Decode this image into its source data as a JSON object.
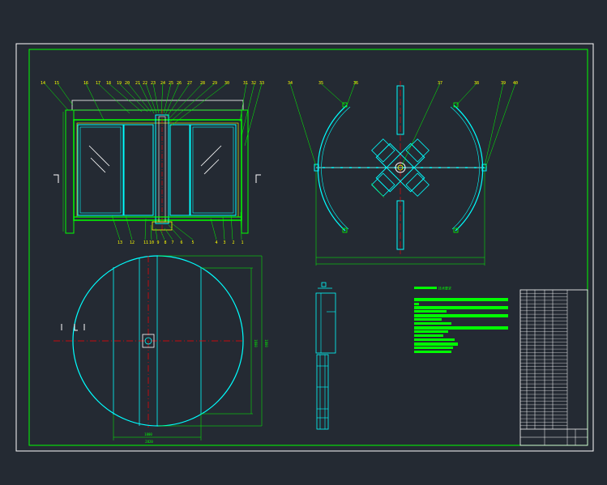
{
  "colors": {
    "background": "#242a33",
    "sheet_border": "#ffffff",
    "frame": "#00ff00",
    "outline": "#00ffff",
    "centerline": "#ff0000",
    "leader": "#00ff00",
    "dimension": "#00ff00",
    "note_text": "#00ff00",
    "glass": "#ffffff",
    "label": "#ffff00"
  },
  "front_view": {
    "top_callouts": [
      "14",
      "15",
      "16",
      "17",
      "18",
      "19",
      "20",
      "21",
      "22",
      "23",
      "24",
      "25",
      "26",
      "27",
      "28",
      "29",
      "30",
      "31",
      "32",
      "33"
    ],
    "bottom_callouts": [
      "13",
      "12",
      "11",
      "10",
      "9",
      "8",
      "7",
      "6",
      "5",
      "4",
      "3",
      "2",
      "1"
    ]
  },
  "plan_view": {
    "callouts": [
      "34",
      "35",
      "36",
      "37",
      "38",
      "39",
      "40"
    ]
  },
  "bottom_plan": {
    "dims": [
      "2820",
      "1000",
      "1600",
      "1800"
    ]
  },
  "notes": {
    "heading": "技术要求"
  },
  "title_block": {
    "rows": 40
  }
}
